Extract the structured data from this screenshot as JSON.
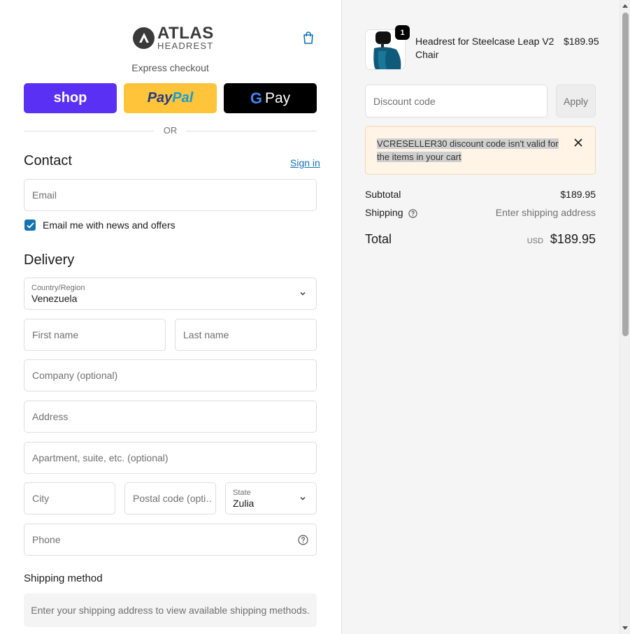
{
  "brand": {
    "name_main": "ATLAS",
    "name_sub": "HEADREST"
  },
  "express": {
    "label": "Express checkout",
    "shop_label": "shop",
    "paypal_part1": "Pay",
    "paypal_part2": "Pal",
    "gpay_g": "G",
    "gpay_label": "Pay",
    "or_text": "OR"
  },
  "contact": {
    "heading": "Contact",
    "signin_label": "Sign in",
    "email_placeholder": "Email",
    "newsletter_label": "Email me with news and offers",
    "newsletter_checked": true
  },
  "delivery": {
    "heading": "Delivery",
    "country_label": "Country/Region",
    "country_value": "Venezuela",
    "first_name_placeholder": "First name",
    "last_name_placeholder": "Last name",
    "company_placeholder": "Company (optional)",
    "address_placeholder": "Address",
    "apartment_placeholder": "Apartment, suite, etc. (optional)",
    "city_placeholder": "City",
    "postal_placeholder": "Postal code (opti…",
    "state_label": "State",
    "state_value": "Zulia",
    "phone_placeholder": "Phone"
  },
  "shipping_method": {
    "heading": "Shipping method",
    "message": "Enter your shipping address to view available shipping methods."
  },
  "cart": {
    "item": {
      "quantity": "1",
      "name": "Headrest for Steelcase Leap V2 Chair",
      "price": "$189.95"
    },
    "discount_placeholder": "Discount code",
    "apply_label": "Apply",
    "notice": "VCRESELLER30 discount code isn't valid for the items in your cart",
    "subtotal_label": "Subtotal",
    "subtotal_value": "$189.95",
    "shipping_label": "Shipping",
    "shipping_value": "Enter shipping address",
    "total_label": "Total",
    "total_currency": "USD",
    "total_value": "$189.95"
  },
  "colors": {
    "accent": "#1773b0",
    "shop": "#5a31f4",
    "paypal": "#ffc439",
    "notice_bg": "#fff4e6"
  }
}
